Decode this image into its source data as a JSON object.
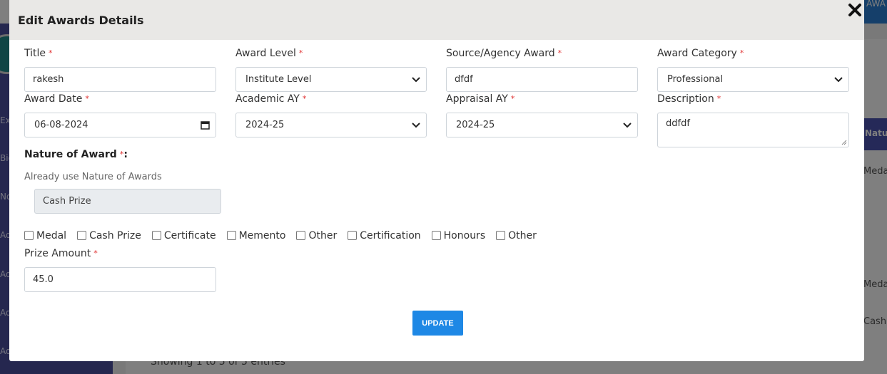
{
  "background": {
    "top_right_fragment": "AWA",
    "table_header_fragment": "Natur",
    "row_fragments": [
      "Meda",
      "Meda",
      "Cash"
    ],
    "sidebar_fragments": [
      "Exa",
      "Bio",
      "No",
      "Ad",
      "Ad",
      "Ad",
      "Ad"
    ],
    "footer": "Showing 1 to 5 of 5 entries"
  },
  "modal": {
    "title": "Edit Awards Details",
    "close_icon": "close-icon",
    "fields": {
      "title": {
        "label": "Title",
        "value": "rakesh"
      },
      "award_level": {
        "label": "Award Level",
        "value": "Institute Level"
      },
      "source_agency": {
        "label": "Source/Agency Award",
        "value": "dfdf"
      },
      "award_category": {
        "label": "Award Category",
        "value": "Professional"
      },
      "award_date": {
        "label": "Award Date",
        "value": "06-08-2024"
      },
      "academic_ay": {
        "label": "Academic AY",
        "value": "2024-25"
      },
      "appraisal_ay": {
        "label": "Appraisal AY",
        "value": "2024-25"
      },
      "description": {
        "label": "Description",
        "value": "ddfdf"
      },
      "prize_amount": {
        "label": "Prize Amount",
        "value": "45.0"
      }
    },
    "required_mark": "*",
    "nature": {
      "label": "Nature of Award",
      "colon": ":",
      "hint": "Already use Nature of Awards",
      "used_value": "Cash Prize",
      "options": [
        "Medal",
        "Cash Prize",
        "Certificate",
        "Memento",
        "Other",
        "Certification",
        "Honours",
        "Other"
      ]
    },
    "update_label": "UPDATE"
  }
}
